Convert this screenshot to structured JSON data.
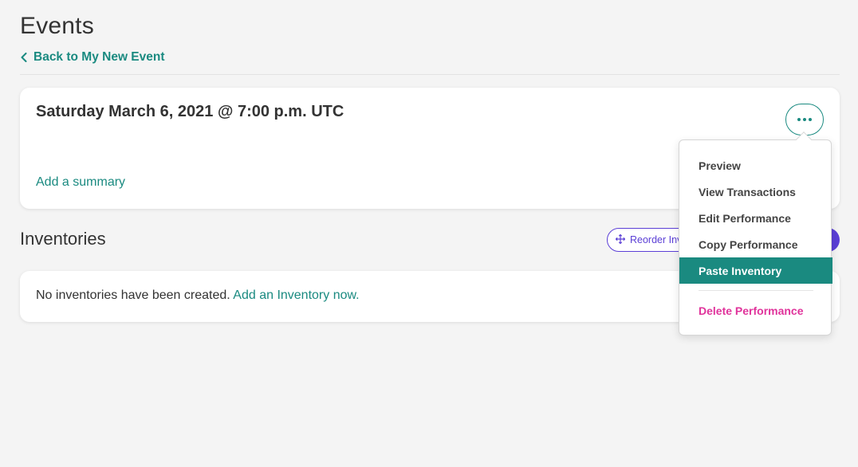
{
  "page": {
    "title": "Events",
    "back_link": "Back to My New Event"
  },
  "performance": {
    "title": "Saturday March 6, 2021 @ 7:00 p.m. UTC",
    "add_summary": "Add a summary"
  },
  "inventories": {
    "heading": "Inventories",
    "reorder_label": "Reorder Inv",
    "empty_text": "No inventories have been created. ",
    "empty_link": "Add an Inventory now."
  },
  "menu": {
    "items": [
      {
        "label": "Preview"
      },
      {
        "label": "View Transactions"
      },
      {
        "label": "Edit Performance"
      },
      {
        "label": "Copy Performance"
      },
      {
        "label": "Paste Inventory",
        "state": "highlighted"
      },
      {
        "label": "Delete Performance",
        "variant": "danger"
      }
    ]
  },
  "colors": {
    "accent": "#1a8a80",
    "primary_purple": "#5b3fd6",
    "danger": "#e0339b",
    "background": "#f4f4f4"
  },
  "icons": {
    "back": "chevron-left-icon",
    "more": "more-horizontal-icon",
    "reorder": "move-arrows-icon"
  }
}
